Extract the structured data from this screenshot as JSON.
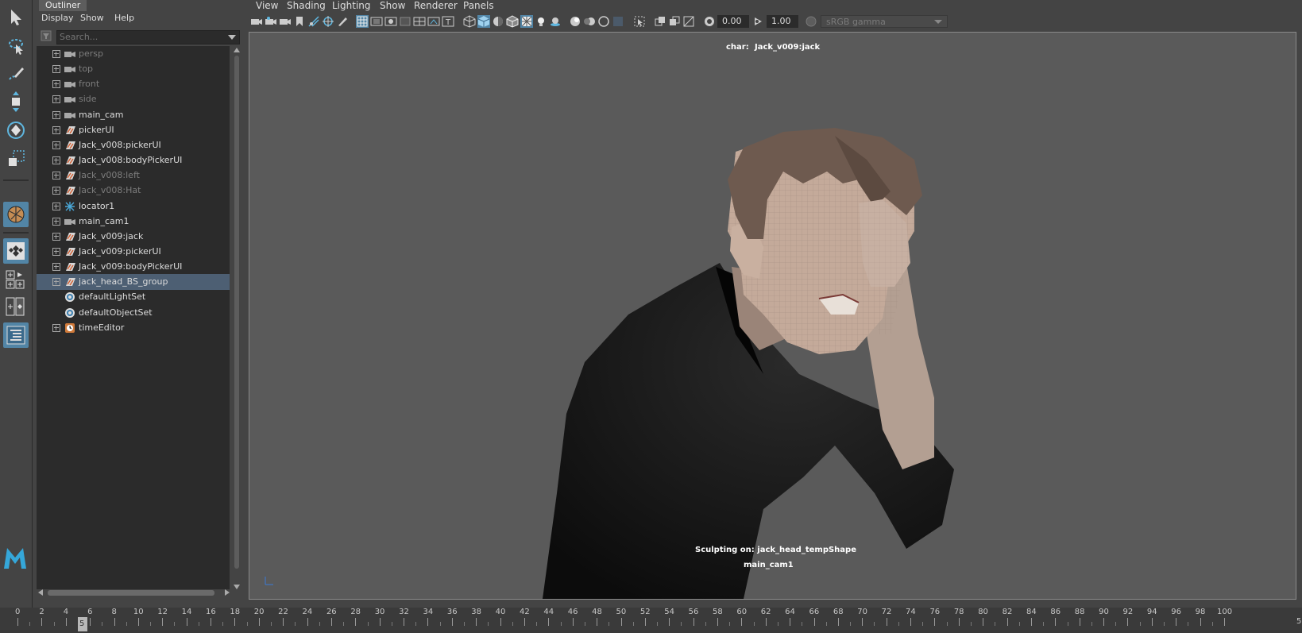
{
  "outliner": {
    "tab_title": "Outliner",
    "menu": [
      "Display",
      "Show",
      "Help"
    ],
    "search_placeholder": "Search...",
    "items": [
      {
        "label": "persp",
        "icon": "camera-icon",
        "dim": true,
        "expandable": true,
        "selected": false
      },
      {
        "label": "top",
        "icon": "camera-icon",
        "dim": true,
        "expandable": true,
        "selected": false
      },
      {
        "label": "front",
        "icon": "camera-icon",
        "dim": true,
        "expandable": true,
        "selected": false
      },
      {
        "label": "side",
        "icon": "camera-icon",
        "dim": true,
        "expandable": true,
        "selected": false
      },
      {
        "label": "main_cam",
        "icon": "camera-icon",
        "dim": false,
        "expandable": true,
        "selected": false
      },
      {
        "label": "pickerUI",
        "icon": "transform-icon",
        "dim": false,
        "expandable": true,
        "selected": false
      },
      {
        "label": "Jack_v008:pickerUI",
        "icon": "transform-icon",
        "dim": false,
        "expandable": true,
        "selected": false
      },
      {
        "label": "Jack_v008:bodyPickerUI",
        "icon": "transform-icon",
        "dim": false,
        "expandable": true,
        "selected": false
      },
      {
        "label": "Jack_v008:left",
        "icon": "transform-icon",
        "dim": true,
        "expandable": true,
        "selected": false
      },
      {
        "label": "Jack_v008:Hat",
        "icon": "transform-icon",
        "dim": true,
        "expandable": true,
        "selected": false
      },
      {
        "label": "locator1",
        "icon": "locator-icon",
        "dim": false,
        "expandable": true,
        "selected": false
      },
      {
        "label": "main_cam1",
        "icon": "camera-icon",
        "dim": false,
        "expandable": true,
        "selected": false
      },
      {
        "label": "Jack_v009:jack",
        "icon": "transform-icon",
        "dim": false,
        "expandable": true,
        "selected": false
      },
      {
        "label": "Jack_v009:pickerUI",
        "icon": "transform-icon",
        "dim": false,
        "expandable": true,
        "selected": false
      },
      {
        "label": "Jack_v009:bodyPickerUI",
        "icon": "transform-icon",
        "dim": false,
        "expandable": true,
        "selected": false
      },
      {
        "label": "jack_head_BS_group",
        "icon": "transform-icon",
        "dim": false,
        "expandable": true,
        "selected": true
      },
      {
        "label": "defaultLightSet",
        "icon": "set-icon",
        "dim": false,
        "expandable": false,
        "selected": false
      },
      {
        "label": "defaultObjectSet",
        "icon": "set-icon",
        "dim": false,
        "expandable": false,
        "selected": false
      },
      {
        "label": "timeEditor",
        "icon": "clock-icon",
        "dim": false,
        "expandable": true,
        "selected": false
      }
    ]
  },
  "viewport": {
    "menu": [
      "View",
      "Shading",
      "Lighting",
      "Show",
      "Renderer",
      "Panels"
    ],
    "exposure_value": "0.00",
    "gamma_value": "1.00",
    "color_space": "sRGB gamma",
    "hud_char_label": "char:",
    "hud_char_value": "Jack_v009:jack",
    "hud_sculpt": "Sculpting on: jack_head_tempShape",
    "hud_camera": "main_cam1"
  },
  "timeline": {
    "labels": [
      "0",
      "2",
      "4",
      "6",
      "8",
      "10",
      "12",
      "14",
      "16",
      "18",
      "20",
      "22",
      "24",
      "26",
      "28",
      "30",
      "32",
      "34",
      "36",
      "38",
      "40",
      "42",
      "44",
      "46",
      "48",
      "50",
      "52",
      "54",
      "56",
      "58",
      "60",
      "62",
      "64",
      "66",
      "68",
      "70",
      "72",
      "74",
      "76",
      "78",
      "80",
      "82",
      "84",
      "86",
      "88",
      "90",
      "92",
      "94",
      "96",
      "98",
      "100"
    ],
    "current_frame": "5",
    "end_label": "5"
  },
  "colors": {
    "selection": "#4d5f73",
    "active_tool": "#5285a6",
    "viewport_bg": "#5a5a5a"
  }
}
